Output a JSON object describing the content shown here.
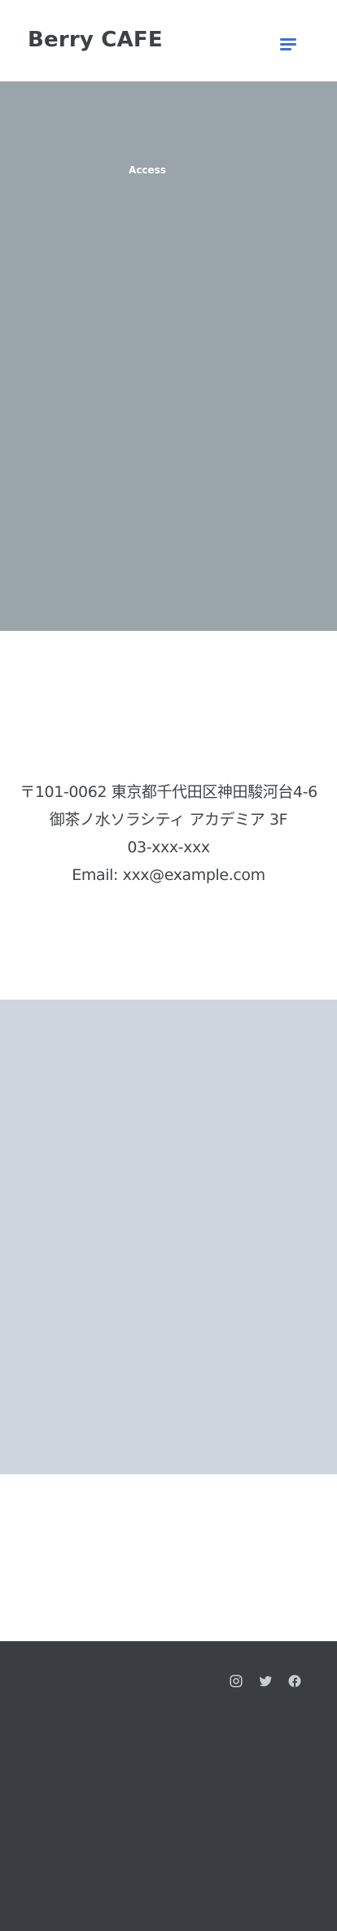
{
  "header": {
    "brand": "Berry CAFE",
    "menu_icon": "hamburger-menu-icon"
  },
  "hero": {
    "title": "Access"
  },
  "access": {
    "address_line1": "〒101-0062 東京都千代田区神田駿河台4-6",
    "address_line2": "御茶ノ水ソラシティ アカデミア 3F",
    "phone": "03-xxx-xxx",
    "email": "Email: xxx@example.com"
  },
  "footer": {
    "social": [
      {
        "name": "instagram",
        "icon": "instagram-icon"
      },
      {
        "name": "twitter",
        "icon": "twitter-icon"
      },
      {
        "name": "facebook",
        "icon": "facebook-icon"
      }
    ]
  },
  "colors": {
    "accent": "#3f6fd0",
    "hero_bg": "#9aa5ab",
    "map_bg": "#ced5de",
    "footer_bg": "#3a3e42",
    "footer_icon": "#c9ced3"
  }
}
